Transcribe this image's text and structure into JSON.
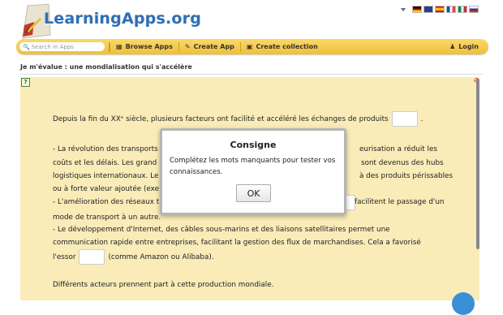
{
  "header": {
    "logo_text": "LearningApps.org",
    "flags": [
      "de",
      "en",
      "es",
      "fr",
      "it",
      "ru"
    ]
  },
  "navbar": {
    "search_placeholder": "Search in Apps",
    "browse_label": "Browse Apps",
    "create_label": "Create App",
    "collection_label": "Create collection",
    "login_label": "Login"
  },
  "app": {
    "title": "Je m'évalue : une mondialisation qui s'accélère"
  },
  "content": {
    "p1": "Depuis la fin du XXᵉ siècle, plusieurs facteurs ont facilité et accéléré les échanges de produits",
    "p2_a": "- La révolution des transports",
    "p2_b": "eurisation a réduit les",
    "p3_a": "coûts et les délais. Les grand",
    "p3_b": "sont devenus des hubs",
    "p4_a": "logistiques internationaux. Le",
    "p4_b": "à des produits périssables",
    "p5": "ou à forte valeur ajoutée (exe",
    "p6_a": "- L'amélioration des réseaux t",
    "p6_b": "facilitent le passage d'un",
    "p7": "mode de transport à un autre.",
    "p8": "- Le développement d'Internet, des câbles sous-marins et des liaisons satellitaires permet une",
    "p9": "communication rapide entre entreprises, facilitant la gestion des flux de marchandises. Cela a favorisé",
    "p10_a": "l'essor",
    "p10_b": "(comme Amazon ou Alibaba).",
    "p11": "Différents acteurs prennent part à cette production mondiale."
  },
  "dialog": {
    "title": "Consigne",
    "message": "Complétez les mots manquants pour tester vos connaissances.",
    "ok_label": "OK"
  }
}
